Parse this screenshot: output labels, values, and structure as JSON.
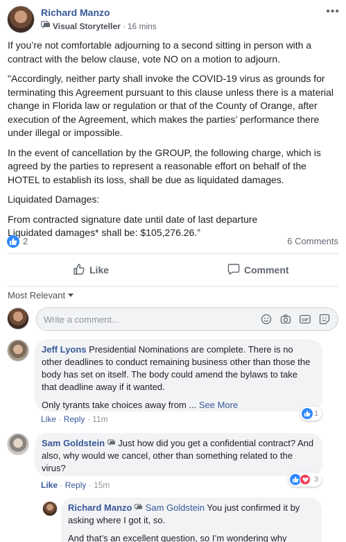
{
  "post": {
    "author": "Richard Manzo",
    "badge": "Visual Storyteller",
    "separator": "·",
    "time": "16 mins",
    "more": "•••",
    "paragraphs": [
      "If you’re not comfortable adjourning to a second sitting in person with a contract with the below clause, vote NO on a motion to adjourn.",
      "\"Accordingly, neither party shall invoke the COVID-19 virus as grounds for terminating this Agreement pursuant to this clause unless there is a material change in Florida law or regulation or that of the County of Orange, after execution of the Agreement, which makes the parties’ performance there under illegal or impossible.",
      "In the event of cancellation by the GROUP, the following charge, which is agreed by the parties to represent a reasonable effort on behalf of the HOTEL to establish its loss, shall be due as liquidated damages.",
      "Liquidated Damages:",
      "From contracted signature date until date of last departure\nLiquidated damages* shall be: $105,276.26.”"
    ],
    "like_count": "2",
    "comment_count": "6 Comments",
    "like_label": "Like",
    "comment_label": "Comment"
  },
  "comments_section": {
    "sort_label": "Most Relevant",
    "input_placeholder": "Write a comment..."
  },
  "comments": [
    {
      "author": "Jeff Lyons",
      "text": "Presidential Nominations are complete. There is no other deadlines to conduct remaining business other than those the body has set on itself. The body could amend the bylaws to take that deadline away if it wanted.",
      "text2": "Only tyrants take choices away from ...",
      "see_more": "See More",
      "like": "Like",
      "reply": "Reply",
      "time": "11m",
      "dot": "·",
      "reaction_count": "1"
    },
    {
      "author": "Sam Goldstein",
      "text": "Just how did you get a confidential contract? And also, why would we cancel, other than something related to the virus?",
      "like": "Like",
      "reply": "Reply",
      "time": "15m",
      "dot": "·",
      "reaction_count": "3"
    },
    {
      "author": "Richard Manzo",
      "mention": "Sam Goldstein",
      "text": "You just confirmed it by asking where I got it, so.",
      "text2": "And that’s an excellent question, so I’m wondering why"
    }
  ],
  "colors": {
    "link": "#385898",
    "like_blue": "#2d88ff",
    "love_red": "#f33e58",
    "bubble_bg": "#f2f3f5"
  }
}
